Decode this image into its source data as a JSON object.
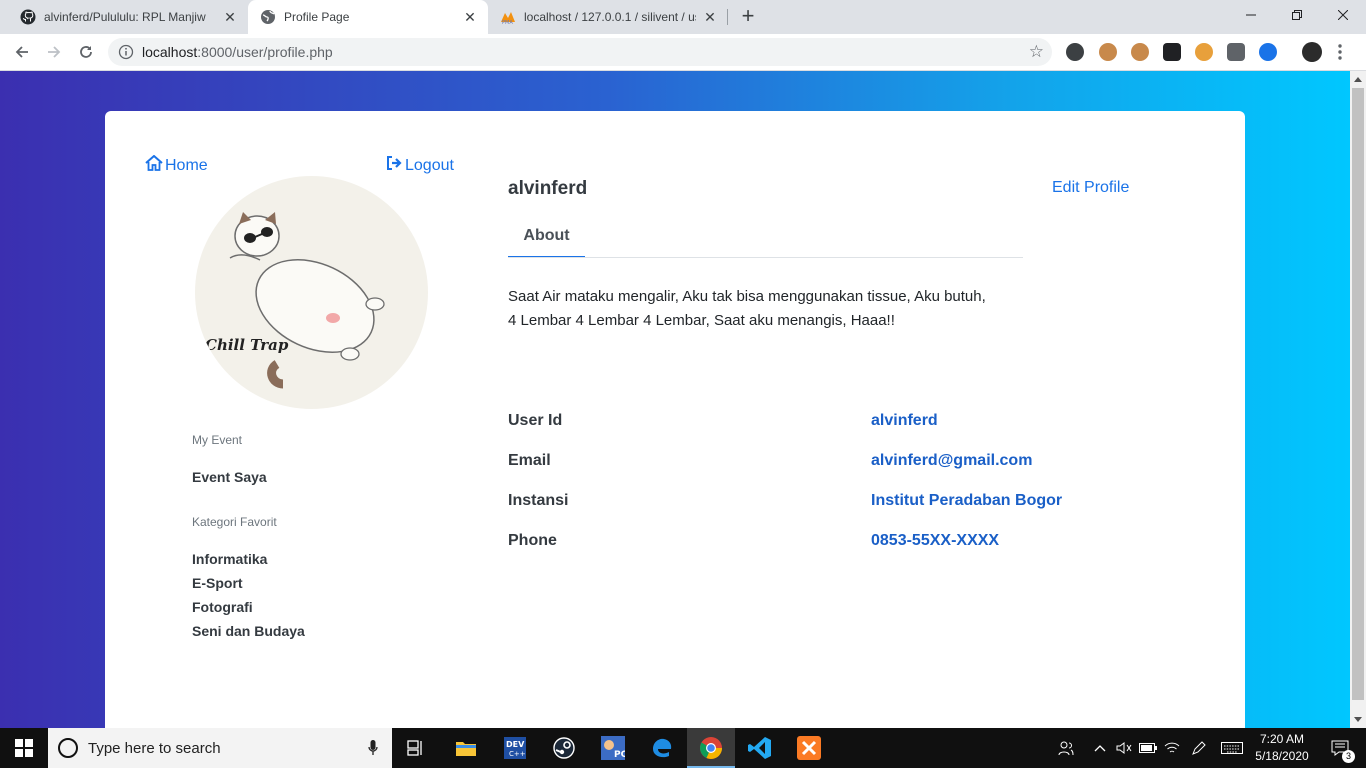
{
  "browser": {
    "tabs": [
      {
        "title": "alvinferd/Pulululu: RPL Manjiw",
        "icon": "github-icon"
      },
      {
        "title": "Profile Page",
        "icon": "globe-icon"
      },
      {
        "title": "localhost / 127.0.0.1 / silivent / us",
        "icon": "phpmyadmin-icon"
      }
    ],
    "url_host": "localhost",
    "url_path": ":8000/user/profile.php"
  },
  "page": {
    "nav": {
      "home": "Home",
      "logout": "Logout"
    },
    "avatar_caption": "Chill Trap",
    "sidebar": {
      "event_label": "My Event",
      "event_item": "Event Saya",
      "category_label": "Kategori Favorit",
      "categories": [
        "Informatika",
        "E-Sport",
        "Fotografi",
        "Seni dan Budaya"
      ]
    },
    "profile": {
      "username": "alvinferd",
      "edit_label": "Edit Profile",
      "tab_label": "About",
      "about_line1": "Saat Air mataku mengalir, Aku tak bisa menggunakan tissue, Aku butuh,",
      "about_line2": "4 Lembar 4 Lembar 4 Lembar, Saat aku menangis, Haaa!!",
      "fields": [
        {
          "label": "User Id",
          "value": "alvinferd"
        },
        {
          "label": "Email",
          "value": "alvinferd@gmail.com"
        },
        {
          "label": "Instansi",
          "value": "Institut Peradaban Bogor"
        },
        {
          "label": "Phone",
          "value": "0853-55XX-XXXX"
        }
      ]
    }
  },
  "taskbar": {
    "search_placeholder": "Type here to search",
    "time": "7:20 AM",
    "date": "5/18/2020",
    "notification_count": "3"
  },
  "colors": {
    "accent": "#1a73e8",
    "value_blue": "#1a5fc7",
    "gradient_start": "#3b2fb0",
    "gradient_end": "#00c7ff"
  }
}
